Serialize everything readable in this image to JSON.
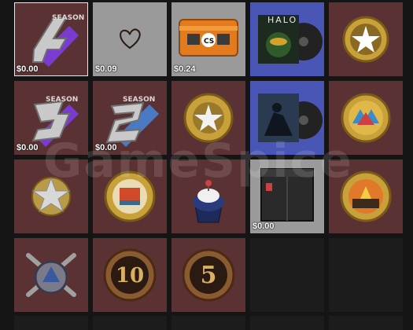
{
  "watermark": "GameSpice",
  "items": [
    {
      "name": "season-4-coin",
      "price": "$0.00",
      "icon": "season-4-coin-icon",
      "bg": "maroon"
    },
    {
      "name": "heart-graffiti",
      "price": "$0.09",
      "icon": "heart-graffiti-icon",
      "bg": "gray"
    },
    {
      "name": "case",
      "price": "$0.24",
      "icon": "weapon-case-icon",
      "bg": "gray"
    },
    {
      "name": "halo-music-kit",
      "price": "",
      "icon": "music-kit-icon",
      "bg": "blue"
    },
    {
      "name": "gold-star-medal",
      "price": "",
      "icon": "medal-icon",
      "bg": "maroon"
    },
    {
      "name": "season-3-coin",
      "price": "$0.00",
      "icon": "season-3-coin-icon",
      "bg": "maroon"
    },
    {
      "name": "season-2-coin",
      "price": "$0.00",
      "icon": "season-2-coin-icon",
      "bg": "maroon"
    },
    {
      "name": "gold-star-coin",
      "price": "",
      "icon": "coin-icon",
      "bg": "maroon"
    },
    {
      "name": "counter-strike-music-kit",
      "price": "",
      "icon": "music-kit-icon",
      "bg": "blue"
    },
    {
      "name": "pin-coin-1",
      "price": "",
      "icon": "coin-icon",
      "bg": "maroon"
    },
    {
      "name": "silver-star-medal",
      "price": "",
      "icon": "medal-icon",
      "bg": "maroon"
    },
    {
      "name": "pin-coin-2",
      "price": "",
      "icon": "coin-icon",
      "bg": "maroon"
    },
    {
      "name": "cupcake-pin",
      "price": "",
      "icon": "cupcake-icon",
      "bg": "maroon"
    },
    {
      "name": "capsule-box",
      "price": "$0.00",
      "icon": "capsule-box-icon",
      "bg": "gray"
    },
    {
      "name": "pin-coin-3",
      "price": "",
      "icon": "coin-icon",
      "bg": "maroon"
    },
    {
      "name": "operation-coin",
      "price": "",
      "icon": "crossed-knives-coin-icon",
      "bg": "maroon"
    },
    {
      "name": "10-year-coin",
      "price": "",
      "icon": "ten-year-coin-icon",
      "bg": "maroon",
      "label": "10"
    },
    {
      "name": "5-year-coin",
      "price": "",
      "icon": "five-year-coin-icon",
      "bg": "maroon",
      "label": "5"
    },
    {
      "name": "empty-slot-1",
      "price": "",
      "icon": "",
      "bg": "empty"
    },
    {
      "name": "empty-slot-2",
      "price": "",
      "icon": "",
      "bg": "empty"
    }
  ],
  "coin_labels": {
    "season4": "SEASON",
    "season3": "SEASON",
    "season2": "SEASON",
    "ten": "10",
    "five": "5",
    "halo": "HALO",
    "cs_logo": "CS"
  },
  "colors": {
    "maroon": "#5b3233",
    "gray": "#9a9a9a",
    "blue": "#4a56b6",
    "empty": "#1c1c1c",
    "gold": "#c9a13b"
  }
}
